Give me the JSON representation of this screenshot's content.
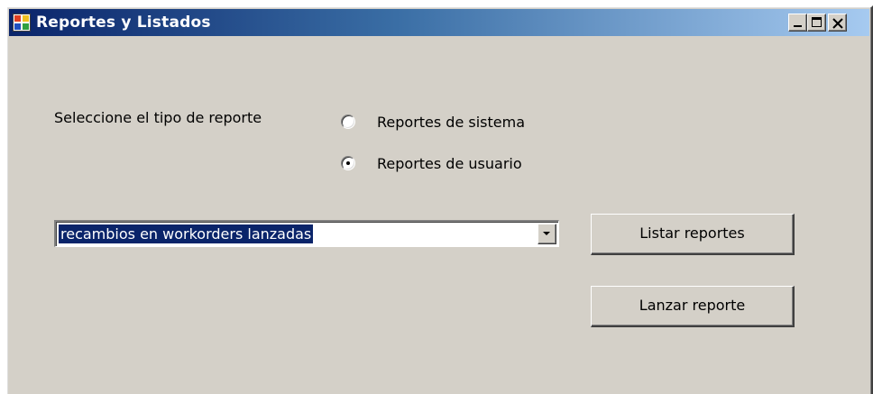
{
  "window": {
    "title": "Reportes y Listados",
    "controls": {
      "minimize": "minimize-icon",
      "maximize": "maximize-icon",
      "close": "close-icon"
    }
  },
  "form": {
    "tipo_label": "Seleccione el tipo de reporte",
    "radio_options": [
      {
        "label": "Reportes de sistema",
        "selected": false
      },
      {
        "label": "Reportes de usuario",
        "selected": true
      }
    ],
    "report_combo": {
      "value": "recambios en workorders lanzadas"
    },
    "buttons": {
      "listar": "Listar reportes",
      "lanzar": "Lanzar reporte"
    }
  },
  "colors": {
    "titlebar_start": "#0a246a",
    "titlebar_end": "#a6caf0",
    "window_face": "#d4d0c8",
    "selection": "#0a246a"
  }
}
